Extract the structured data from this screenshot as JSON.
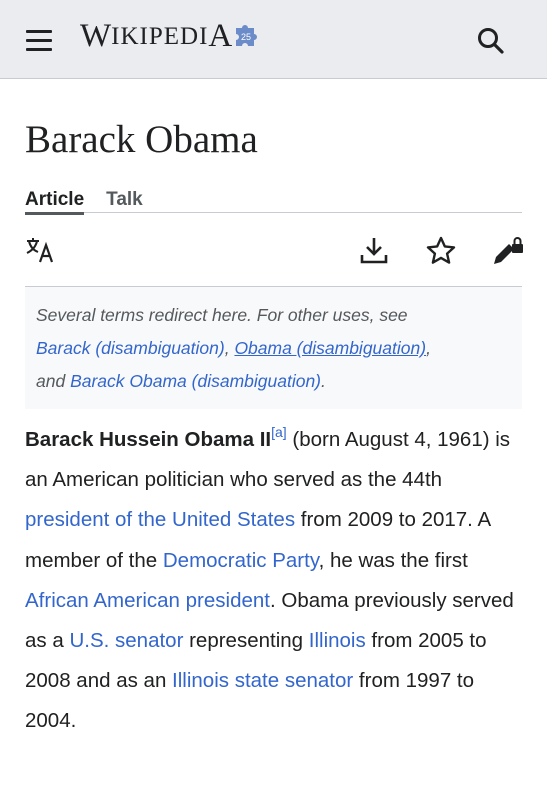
{
  "header": {
    "logo_first": "W",
    "logo_rest": "IKIPEDI",
    "logo_last": "A",
    "badge_text": "25"
  },
  "page": {
    "title": "Barack Obama",
    "tabs": [
      {
        "label": "Article"
      },
      {
        "label": "Talk"
      }
    ]
  },
  "toolbar": {
    "icons": [
      "language-icon",
      "download-icon",
      "star-icon",
      "edit-lock-icon"
    ]
  },
  "hatnote": {
    "intro": "Several terms redirect here. For other uses, see",
    "link1": "Barack (disambiguation)",
    "sep1": ", ",
    "link2": "Obama (disambiguation)",
    "sep2": ",",
    "and": "and ",
    "link3": "Barack Obama (disambiguation)",
    "end": "."
  },
  "lead": {
    "name": "Barack Hussein Obama II",
    "note": "[a]",
    "t1": " (born August 4, 1961) is an American politician who served as the 44th ",
    "l1": "president of the United States",
    "t2": " from 2009 to 2017. A member of the ",
    "l2": "Democratic Party",
    "t3": ", he was the first ",
    "l3": "African American president",
    "t4": ". Obama previously served as a ",
    "l4": "U.S. senator",
    "t5": " representing ",
    "l5": "Illinois",
    "t6": " from 2005 to 2008 and as an ",
    "l6": "Illinois state senator",
    "t7": " from 1997 to 2004."
  },
  "colors": {
    "link": "#3366cc",
    "text": "#202122",
    "header_bg": "#eaecf0",
    "hatnote_bg": "#f8f9fa"
  }
}
